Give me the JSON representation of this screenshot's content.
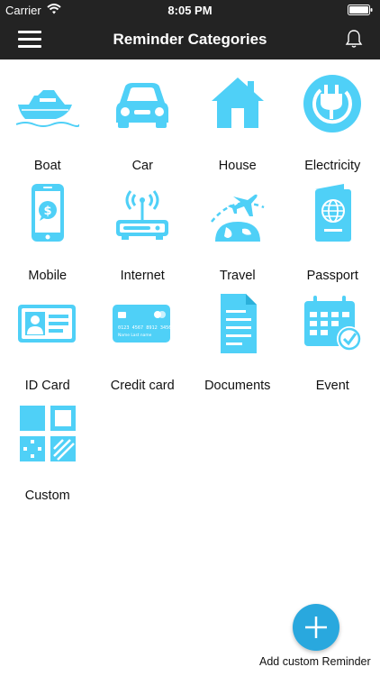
{
  "status_bar": {
    "carrier": "Carrier",
    "time": "8:05 PM"
  },
  "header": {
    "title": "Reminder Categories"
  },
  "categories": [
    {
      "label": "Boat",
      "icon": "boat-icon"
    },
    {
      "label": "Car",
      "icon": "car-icon"
    },
    {
      "label": "House",
      "icon": "house-icon"
    },
    {
      "label": "Electricity",
      "icon": "electricity-icon"
    },
    {
      "label": "Mobile",
      "icon": "mobile-icon"
    },
    {
      "label": "Internet",
      "icon": "router-icon"
    },
    {
      "label": "Travel",
      "icon": "airplane-icon"
    },
    {
      "label": "Passport",
      "icon": "passport-icon"
    },
    {
      "label": "ID Card",
      "icon": "id-card-icon"
    },
    {
      "label": "Credit card",
      "icon": "credit-card-icon"
    },
    {
      "label": "Documents",
      "icon": "document-icon"
    },
    {
      "label": "Event",
      "icon": "calendar-icon"
    },
    {
      "label": "Custom",
      "icon": "custom-grid-icon"
    }
  ],
  "card_number_text": "0123 4567 8912 3456",
  "card_name_text": "Name Last name",
  "fab": {
    "label": "Add custom Reminder"
  },
  "colors": {
    "accent": "#29a8de",
    "icon_blue": "#4fd0f7",
    "bar": "#232323"
  }
}
